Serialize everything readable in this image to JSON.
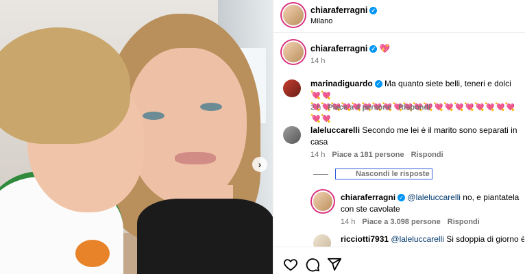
{
  "post": {
    "author": "chiaraferragni",
    "location": "Milano"
  },
  "caption": {
    "author": "chiaraferragni",
    "text": "💖",
    "time": "14 h"
  },
  "comments": [
    {
      "author": "marinadiguardo",
      "verified": true,
      "text_line1": "Ma quanto siete belli, teneri e dolci💘💘",
      "text_line2": "💘💘💘💘💘💘💘💘💘💘💘💘💘💘💘💘💘💘💘💘💘💘",
      "time": "2 h",
      "likes": "Piace a 4 persone",
      "reply": "Rispondi"
    },
    {
      "author": "laleluccarelli",
      "verified": false,
      "text_line1": "Secondo me lei è il marito sono separati in",
      "text_line2": "casa",
      "time": "14 h",
      "likes": "Piace a 181 persone",
      "reply": "Rispondi"
    }
  ],
  "hide_replies_label": "Nascondi le risposte",
  "replies": [
    {
      "author": "chiaraferragni",
      "mention": "@laleluccarelli",
      "text_line1": " no, e piantatela",
      "text_line2": "con ste cavolate",
      "time": "14 h",
      "likes": "Piace a 3.098 persone",
      "reply": "Rispondi"
    },
    {
      "author": "ricciotti7931",
      "mention": "@laleluccarelli",
      "text_line1": " Si sdoppia di giorno è"
    }
  ],
  "icons": [
    "heart-icon",
    "comment-icon",
    "share-icon",
    "next-arrow-icon",
    "verified-icon"
  ],
  "colors": {
    "accent": "#0095f6",
    "story_ring": "#d8317c",
    "muted": "#737373"
  }
}
